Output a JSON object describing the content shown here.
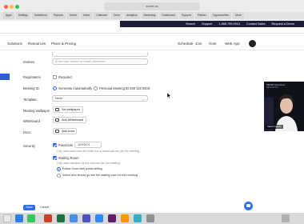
{
  "browser": {
    "address": "zoom.us",
    "tabs": [
      "Apps",
      "Settings",
      "Salesforce",
      "Reports",
      "Home",
      "Inbox",
      "Calendar",
      "Drive",
      "Analytics",
      "Marketing",
      "Dashboard",
      "Support",
      "Partner",
      "Opportunities",
      "More"
    ]
  },
  "zoom_header": {
    "topbar": {
      "search": "Search",
      "support": "Support",
      "phone": "1.888.799.0914",
      "contact_sales": "Contact Sales",
      "request_demo": "Request a Demo"
    },
    "nav_left": [
      "Solutions",
      "Resources",
      "Plans & Pricing"
    ],
    "nav_right": [
      "Schedule",
      "Join",
      "Host",
      "Web App"
    ]
  },
  "form": {
    "attendees_label": "Invitees",
    "attendees_placeholder": "Enter user names or email addresses",
    "registration_label": "Registration",
    "registration_option": "Required",
    "meeting_id_label": "Meeting ID",
    "meeting_id_auto": "Generate Automatically",
    "meeting_id_personal": "Personal Meeting ID 930 116 9403",
    "template_label": "Template",
    "template_value": "None",
    "wallpaper_label": "Meeting wallpaper",
    "wallpaper_button": "Set wallpaper",
    "whiteboard_label": "Whiteboard",
    "whiteboard_button": "Add Whiteboard",
    "docs_label": "Docs",
    "docs_button": "Add Docs",
    "security_label": "Security",
    "passcode_label": "Passcode",
    "passcode_value": "1DXGC4",
    "passcode_help": "Only users who have the invite link or passcode can join the meeting",
    "waiting_room_label": "Waiting Room",
    "waiting_room_help": "Only users admitted by the host can join the meeting",
    "wr_option_1": "Follow Zoom web portal setting",
    "wr_option_2": "Select who should go into the waiting room for this meeting",
    "save": "Save",
    "cancel": "Cancel"
  },
  "video": {
    "caption": "SMART Recruiters",
    "sub": "RECRUITING",
    "name": "Sarah Fogarty"
  },
  "colors": {
    "accent": "#2f6cf0",
    "header": "#1b1b3a"
  }
}
